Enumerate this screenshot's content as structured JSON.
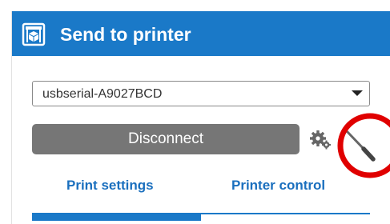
{
  "header": {
    "title": "Send to printer",
    "icon": "printer-cube-icon",
    "background_color": "#1a79c8"
  },
  "connection": {
    "port_select": {
      "selected_value": "usbserial-A9027BCD",
      "icon": "chevron-down-icon"
    },
    "disconnect_label": "Disconnect",
    "settings_icon": "gear-icon",
    "tools_icon": "wrench-icon"
  },
  "annotation": {
    "highlight_color": "#e00000",
    "target": "wrench-icon"
  },
  "tabs": [
    {
      "label": "Print settings",
      "active": true
    },
    {
      "label": "Printer control",
      "active": false
    }
  ],
  "colors": {
    "accent": "#1a79c8",
    "tab_text": "#1a6fbe",
    "button_gray": "#767676"
  }
}
